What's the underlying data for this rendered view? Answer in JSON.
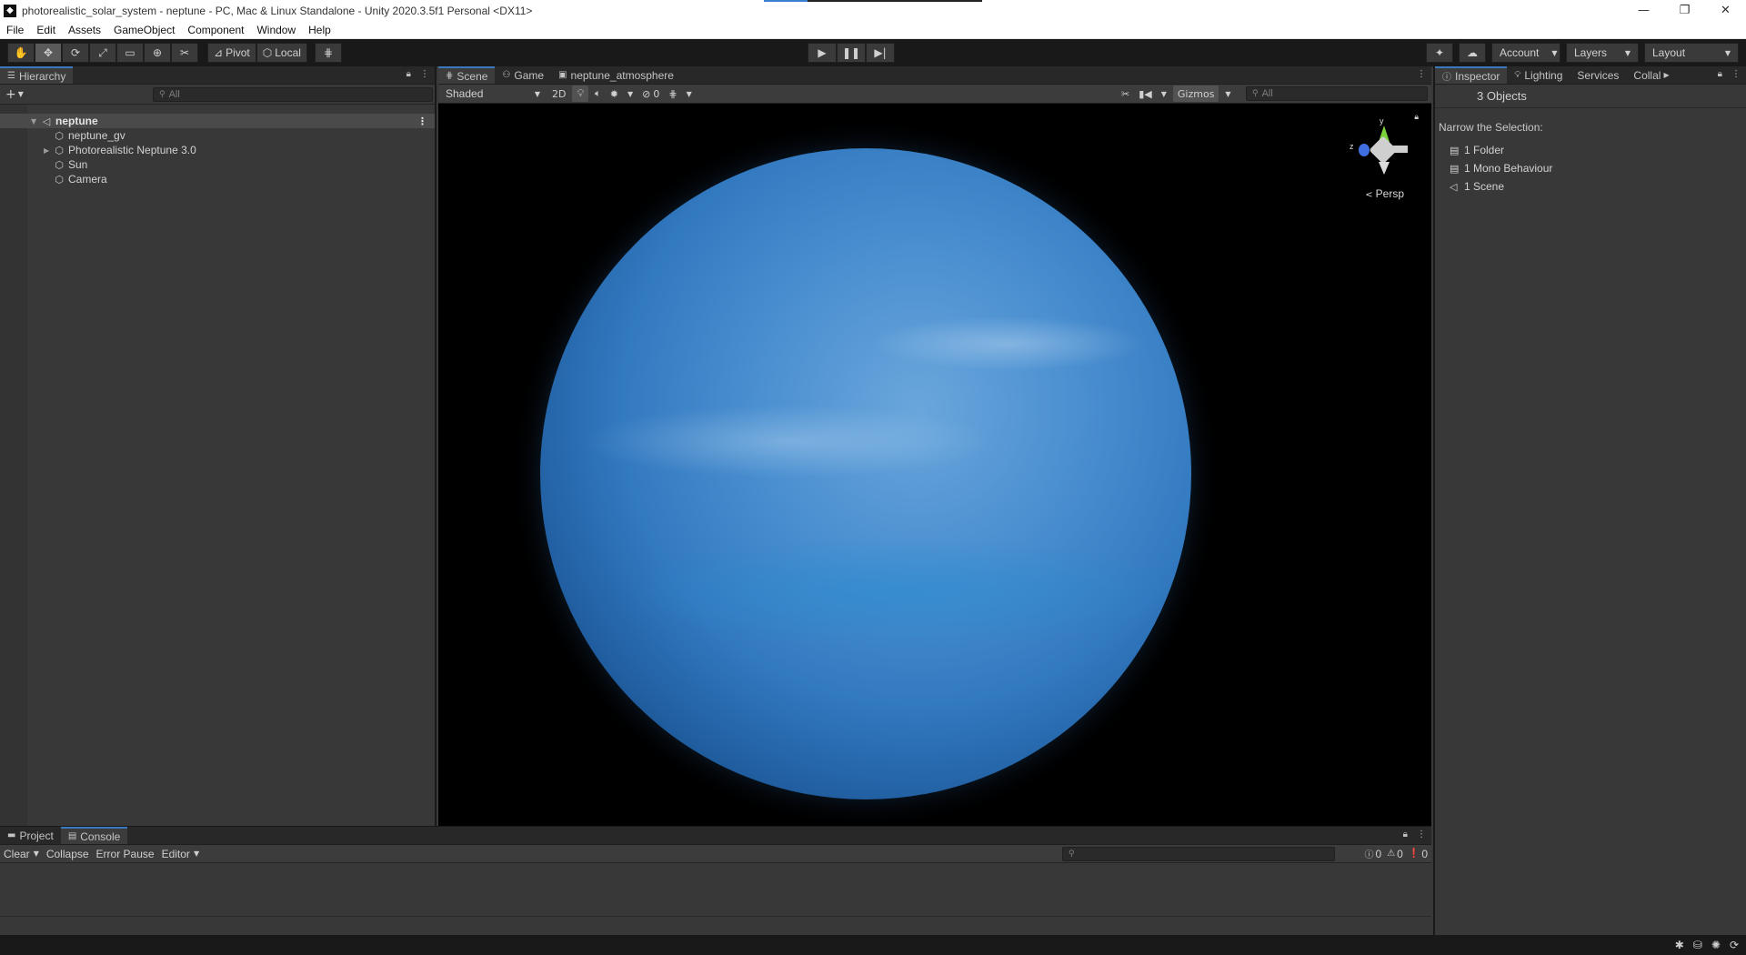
{
  "window": {
    "title": "photorealistic_solar_system - neptune - PC, Mac & Linux Standalone - Unity 2020.3.5f1 Personal <DX11>"
  },
  "menu": [
    "File",
    "Edit",
    "Assets",
    "GameObject",
    "Component",
    "Window",
    "Help"
  ],
  "toolbar": {
    "pivot_label": "Pivot",
    "local_label": "Local",
    "account_label": "Account",
    "layers_label": "Layers",
    "layout_label": "Layout"
  },
  "hierarchy": {
    "tab_label": "Hierarchy",
    "search_placeholder": "All",
    "scene_name": "neptune",
    "items": [
      {
        "label": "neptune_gv"
      },
      {
        "label": "Photorealistic Neptune 3.0"
      },
      {
        "label": "Sun"
      },
      {
        "label": "Camera"
      }
    ]
  },
  "scene": {
    "tabs": [
      {
        "label": "Scene"
      },
      {
        "label": "Game"
      },
      {
        "label": "neptune_atmosphere"
      }
    ],
    "shading_mode": "Shaded",
    "mode_2d": "2D",
    "hidden_count": "0",
    "gizmos_label": "Gizmos",
    "search_placeholder": "All",
    "gizmo_y": "y",
    "gizmo_z": "z",
    "projection": "Persp"
  },
  "inspector": {
    "tabs": [
      {
        "label": "Inspector"
      },
      {
        "label": "Lighting"
      },
      {
        "label": "Services"
      },
      {
        "label": "Collal"
      }
    ],
    "header": "3 Objects",
    "narrow_label": "Narrow the Selection:",
    "selection": [
      {
        "label": "1 Folder"
      },
      {
        "label": "1 Mono Behaviour"
      },
      {
        "label": "1 Scene"
      }
    ]
  },
  "console": {
    "tabs": [
      {
        "label": "Project"
      },
      {
        "label": "Console"
      }
    ],
    "clear_label": "Clear",
    "collapse_label": "Collapse",
    "error_pause_label": "Error Pause",
    "editor_label": "Editor",
    "log_count": "0",
    "warning_count": "0",
    "error_count": "0"
  },
  "colors": {
    "accent": "#3a79bb",
    "planet": "#4a8fd0",
    "gizmo_y": "#7bd33c",
    "gizmo_z": "#3f6fe0"
  }
}
